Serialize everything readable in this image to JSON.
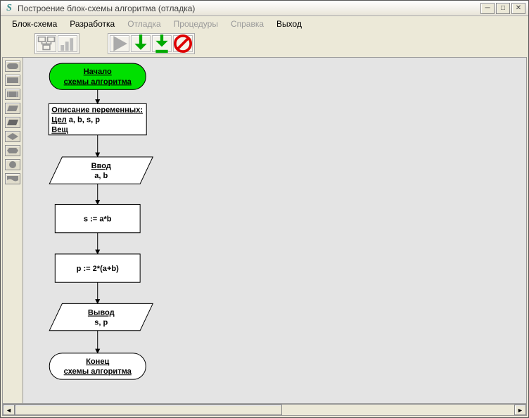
{
  "window": {
    "title": "Построение блок-схемы алгоритма (отладка)"
  },
  "menu": {
    "block": "Блок-схема",
    "dev": "Разработка",
    "debug": "Отладка",
    "proc": "Процедуры",
    "help": "Справка",
    "exit": "Выход"
  },
  "flow": {
    "start_l1": "Начало",
    "start_l2": "схемы алгоритма",
    "decl_title": "Описание переменных:",
    "decl_int": "Цел",
    "decl_int_vars": "a, b, s, p",
    "decl_real": "Вещ",
    "input_l1": "Ввод",
    "input_l2": "a, b",
    "proc1": "s := a*b",
    "proc2": "p := 2*(a+b)",
    "output_l1": "Вывод",
    "output_l2": "s, p",
    "end_l1": "Конец",
    "end_l2": "схемы алгоритма"
  },
  "chart_data": {
    "type": "flowchart",
    "title": "",
    "nodes": [
      {
        "id": "start",
        "kind": "terminator",
        "label": "Начало схемы алгоритма",
        "fill": "#00e000"
      },
      {
        "id": "decl",
        "kind": "declaration",
        "label": "Описание переменных: Цел a, b, s, p; Вещ"
      },
      {
        "id": "in",
        "kind": "io",
        "label": "Ввод a, b"
      },
      {
        "id": "p1",
        "kind": "process",
        "label": "s := a*b"
      },
      {
        "id": "p2",
        "kind": "process",
        "label": "p := 2*(a+b)"
      },
      {
        "id": "out",
        "kind": "io",
        "label": "Вывод s, p"
      },
      {
        "id": "end",
        "kind": "terminator",
        "label": "Конец схемы алгоритма",
        "fill": "#ffffff"
      }
    ],
    "edges": [
      [
        "start",
        "decl"
      ],
      [
        "decl",
        "in"
      ],
      [
        "in",
        "p1"
      ],
      [
        "p1",
        "p2"
      ],
      [
        "p2",
        "out"
      ],
      [
        "out",
        "end"
      ]
    ]
  }
}
